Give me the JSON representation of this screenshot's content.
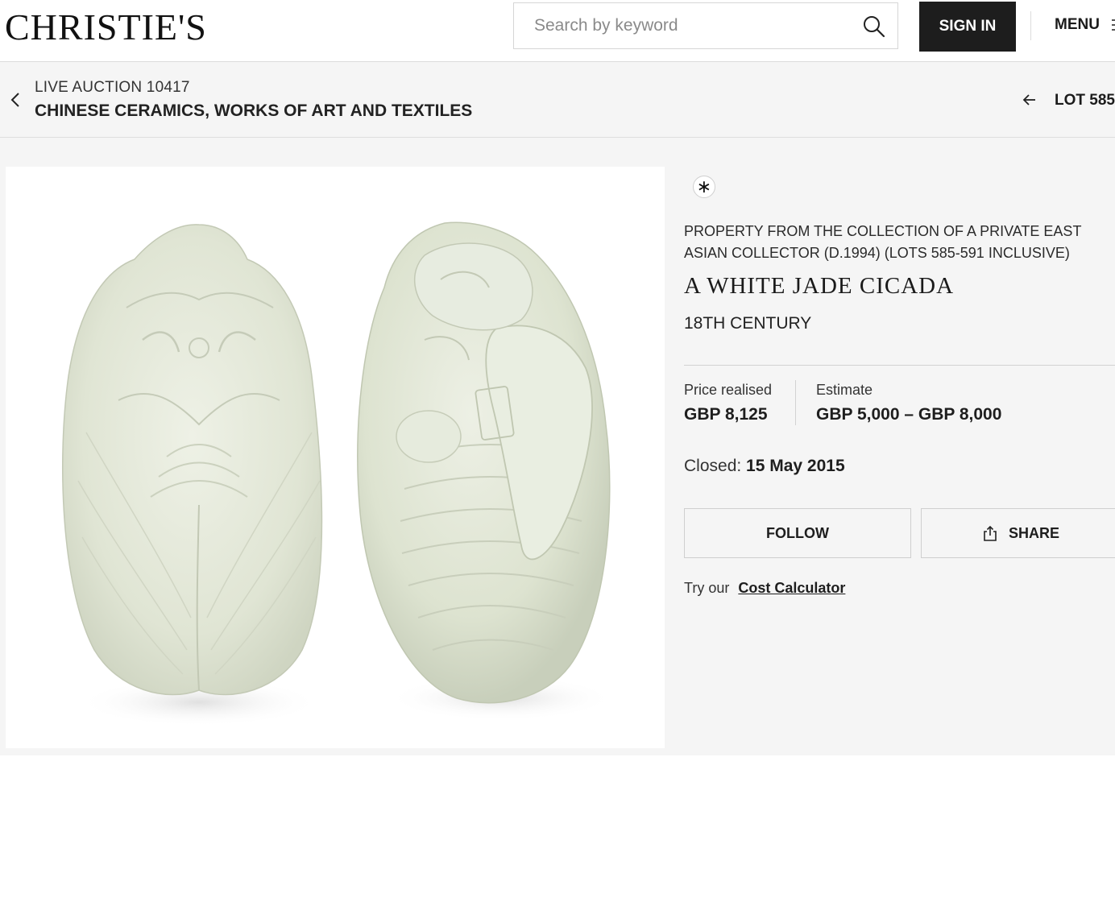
{
  "header": {
    "logo_text": "CHRISTIE'S",
    "search_placeholder": "Search by keyword",
    "signin_label": "SIGN IN",
    "menu_label": "MENU"
  },
  "auction": {
    "label": "LIVE AUCTION 10417",
    "title": "CHINESE CERAMICS, WORKS OF ART AND TEXTILES",
    "lot_label": "LOT 585"
  },
  "lot": {
    "symbol": "∗",
    "provenance": "PROPERTY FROM THE COLLECTION OF A PRIVATE EAST ASIAN COLLECTOR (D.1994) (LOTS 585-591 INCLUSIVE)",
    "title": "A WHITE JADE CICADA",
    "subtitle": "18TH CENTURY",
    "price_label": "Price realised",
    "price_value": "GBP 8,125",
    "estimate_label": "Estimate",
    "estimate_value": "GBP 5,000 – GBP 8,000",
    "closed_label": "Closed:",
    "closed_value": "15 May 2015",
    "follow_label": "FOLLOW",
    "share_label": "SHARE",
    "calc_prefix": "Try our",
    "calc_link": "Cost Calculator"
  },
  "colors": {
    "accent_dark": "#1d1d1d",
    "panel_bg": "#f5f5f5",
    "jade": "#e3e8d8"
  }
}
